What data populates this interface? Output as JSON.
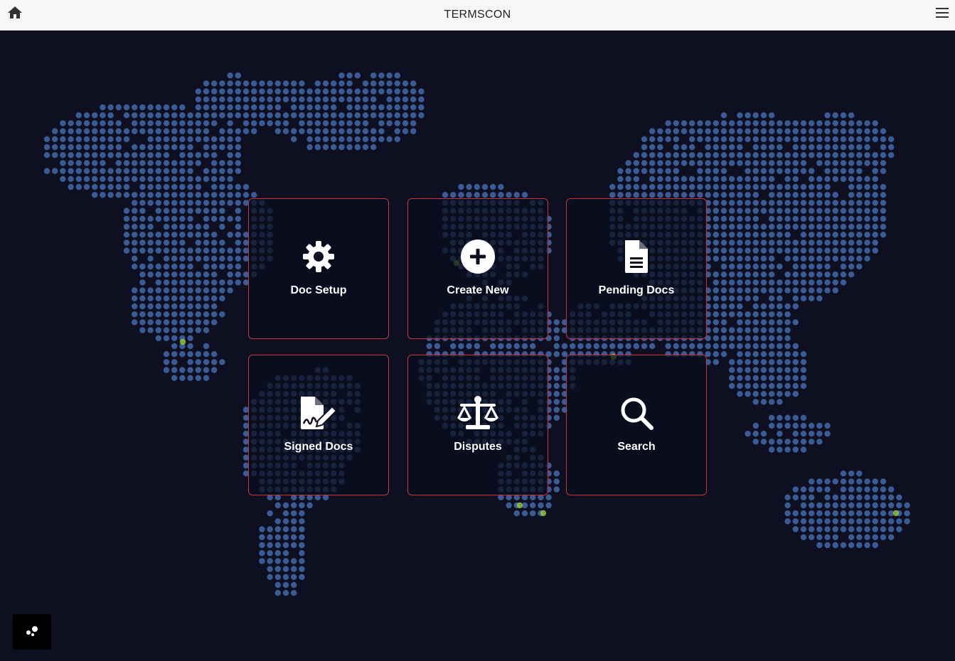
{
  "header": {
    "title": "TERMSCON",
    "home_icon": "home-icon",
    "menu_icon": "hamburger-menu-icon"
  },
  "tiles": [
    {
      "label": "Doc Setup",
      "icon": "gear-icon"
    },
    {
      "label": "Create New",
      "icon": "plus-circle-icon"
    },
    {
      "label": "Pending Docs",
      "icon": "document-icon"
    },
    {
      "label": "Signed Docs",
      "icon": "signed-document-icon"
    },
    {
      "label": "Disputes",
      "icon": "scales-icon"
    },
    {
      "label": "Search",
      "icon": "search-icon"
    }
  ],
  "fab": {
    "icon": "chat-bubbles-icon"
  },
  "colors": {
    "background": "#0e1022",
    "map_dot": "#3b5b94",
    "map_highlight": "#9ccc3c",
    "tile_border": "#c8323c",
    "header_bg": "#f7f7f7"
  }
}
